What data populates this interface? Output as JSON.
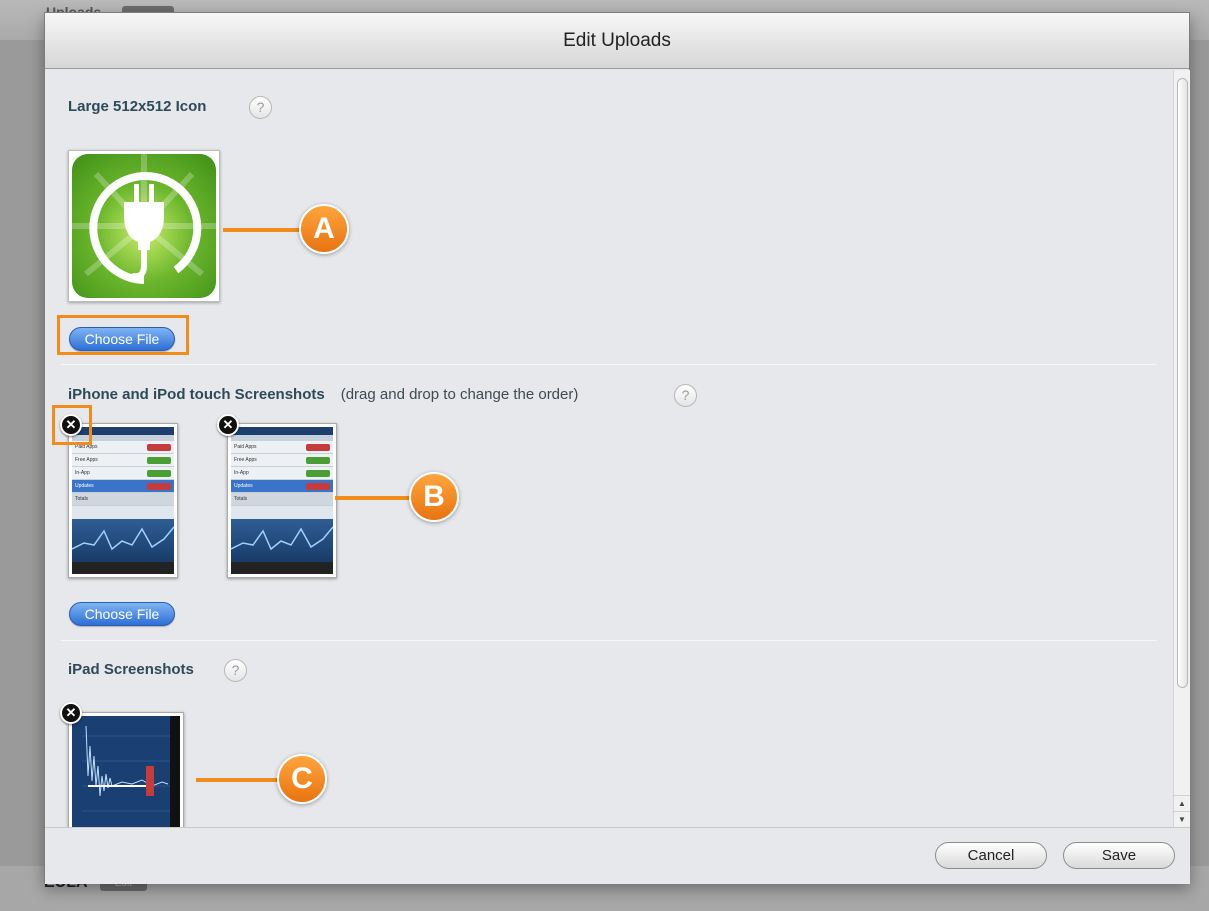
{
  "background": {
    "top_label": "Uploads",
    "bottom_label": "EULA",
    "bottom_tag": "Edit"
  },
  "dialog": {
    "title": "Edit Uploads"
  },
  "sections": {
    "icon": {
      "title": "Large 512x512 Icon",
      "help": "?",
      "choose_file": "Choose File"
    },
    "iphone": {
      "title": "iPhone and iPod touch Screenshots",
      "note": "(drag and drop to change the order)",
      "help": "?",
      "choose_file": "Choose File",
      "remove": "✕"
    },
    "ipad": {
      "title": "iPad Screenshots",
      "help": "?",
      "remove": "✕"
    }
  },
  "screenshot_rows": [
    "Paid Apps",
    "Free Apps",
    "In-App",
    "Updates",
    "Totals"
  ],
  "callouts": [
    "A",
    "B",
    "C"
  ],
  "footer": {
    "cancel": "Cancel",
    "save": "Save"
  },
  "colors": {
    "accent_orange": "#f08b1d",
    "button_blue": "#2e6fd6",
    "section_title": "#2e4a59"
  }
}
